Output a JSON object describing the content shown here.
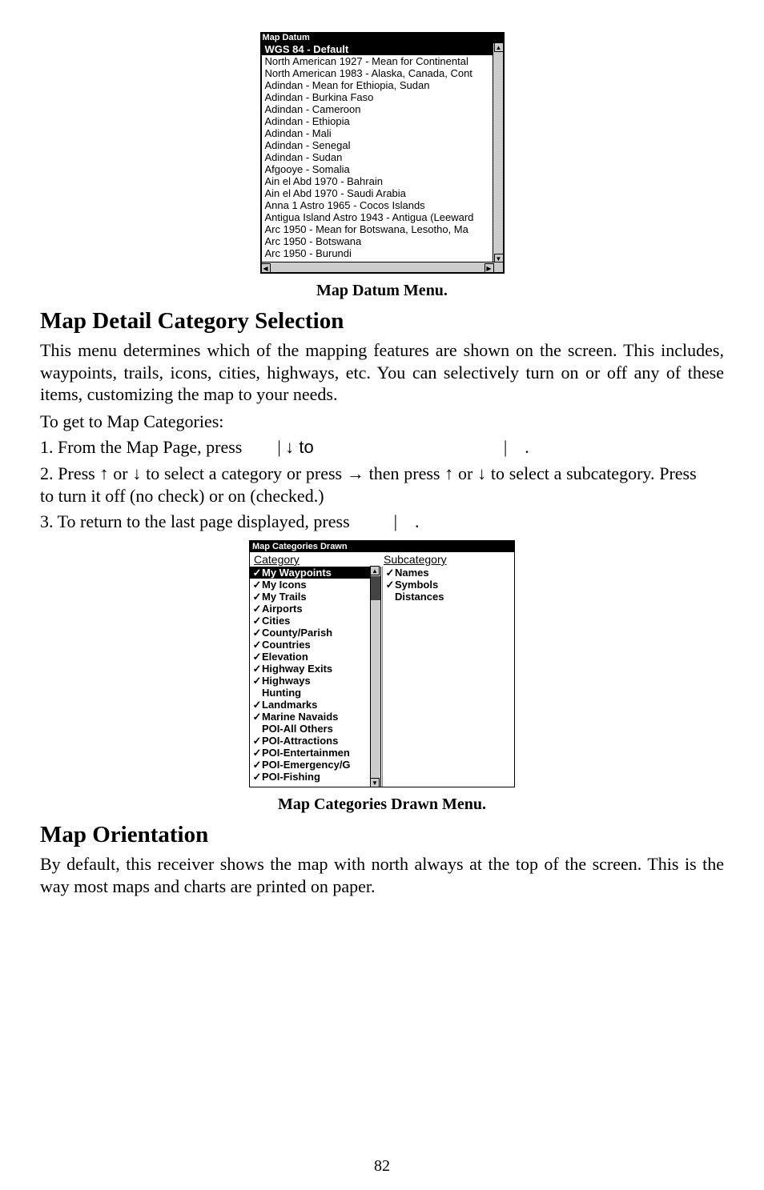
{
  "mapDatum": {
    "title": "Map Datum",
    "items": [
      "WGS 84 - Default",
      "North American 1927 - Mean for Continental",
      "North American 1983 - Alaska, Canada, Cont",
      "Adindan - Mean for Ethiopia, Sudan",
      "Adindan - Burkina Faso",
      "Adindan - Cameroon",
      "Adindan - Ethiopia",
      "Adindan - Mali",
      "Adindan - Senegal",
      "Adindan - Sudan",
      "Afgooye - Somalia",
      "Ain el Abd 1970 - Bahrain",
      "Ain el Abd 1970 - Saudi Arabia",
      "Anna 1 Astro 1965 - Cocos Islands",
      "Antigua Island Astro 1943 - Antigua (Leeward",
      "Arc 1950 - Mean for Botswana, Lesotho, Ma",
      "Arc 1950 - Botswana",
      "Arc 1950 - Burundi"
    ],
    "caption": "Map Datum Menu."
  },
  "section1": {
    "heading": "Map Detail Category Selection",
    "p1": "This menu determines which of the mapping features are shown on the screen. This includes, waypoints, trails, icons, cities, highways, etc. You can selectively turn on or off any of these items, customizing the map to your needs.",
    "p2": "To get to Map Categories:",
    "step1a": "1. From the Map Page, press ",
    "step1b": "|",
    "step1c": "↓ to ",
    "step1d": "|    .",
    "step2a": "2. Press ↑ or ↓ to select a category or press → then press ↑ or ↓ to select a subcategory. Press ",
    "step2b": " to turn it off (no check) or on (checked.)",
    "step3a": "3. To return to the last page displayed, press ",
    "step3b": "|    ."
  },
  "catShot": {
    "title": "Map Categories Drawn",
    "hdrL": "Category",
    "hdrR": "Subcategory",
    "left": [
      {
        "c": true,
        "t": "My Waypoints",
        "sel": true
      },
      {
        "c": true,
        "t": "My Icons"
      },
      {
        "c": true,
        "t": "My Trails"
      },
      {
        "c": true,
        "t": "Airports"
      },
      {
        "c": true,
        "t": "Cities"
      },
      {
        "c": true,
        "t": "County/Parish"
      },
      {
        "c": true,
        "t": "Countries"
      },
      {
        "c": true,
        "t": "Elevation"
      },
      {
        "c": true,
        "t": "Highway Exits"
      },
      {
        "c": true,
        "t": "Highways"
      },
      {
        "c": false,
        "t": "Hunting"
      },
      {
        "c": true,
        "t": "Landmarks"
      },
      {
        "c": true,
        "t": "Marine Navaids"
      },
      {
        "c": false,
        "t": "POI-All Others"
      },
      {
        "c": true,
        "t": "POI-Attractions"
      },
      {
        "c": true,
        "t": "POI-Entertainmen"
      },
      {
        "c": true,
        "t": "POI-Emergency/G"
      },
      {
        "c": true,
        "t": "POI-Fishing"
      }
    ],
    "right": [
      {
        "c": true,
        "t": "Names"
      },
      {
        "c": true,
        "t": "Symbols"
      },
      {
        "c": false,
        "t": "Distances"
      }
    ],
    "caption": "Map Categories Drawn Menu."
  },
  "section2": {
    "heading": "Map Orientation",
    "p1": "By default, this receiver shows the map with north always at the top of the screen. This is the way most maps and charts are printed on paper."
  },
  "pageNumber": "82"
}
